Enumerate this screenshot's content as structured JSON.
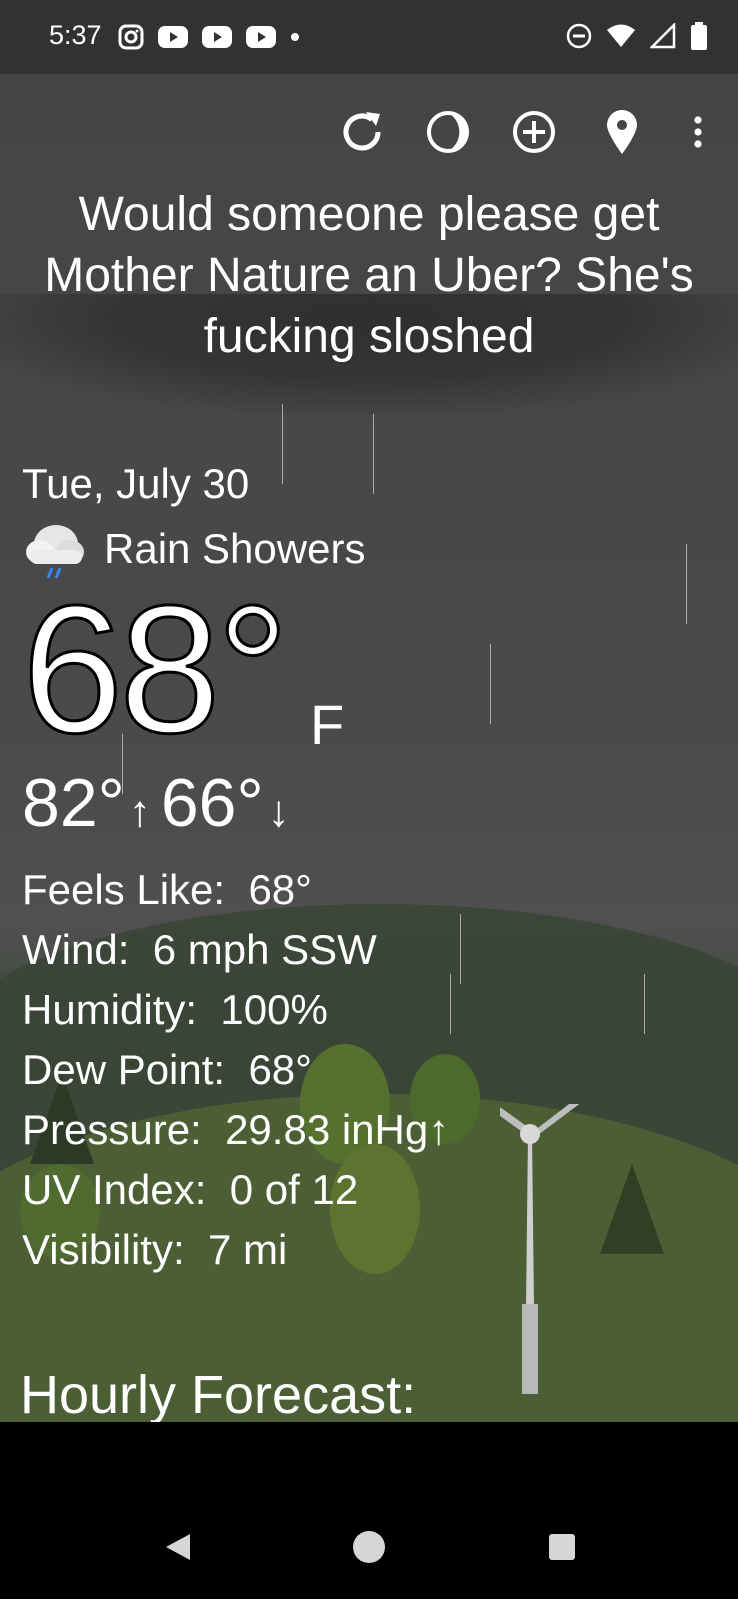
{
  "status_bar": {
    "time": "5:37",
    "left_icons": [
      "instagram-icon",
      "youtube-icon",
      "youtube-icon",
      "youtube-icon",
      "dot-icon"
    ],
    "right_icons": [
      "dnd-icon",
      "wifi-icon",
      "signal-icon",
      "battery-icon"
    ]
  },
  "toolbar": {
    "icons": [
      "refresh-icon",
      "moon-phase-icon",
      "add-location-icon",
      "location-pin-icon",
      "more-vert-icon"
    ]
  },
  "headline": "Would someone please get Mother Nature an Uber? She's fucking sloshed",
  "weather": {
    "date": "Tue, July 30",
    "condition": "Rain Showers",
    "condition_icon": "rain-cloud-icon",
    "temperature": "68°",
    "unit": "F",
    "high": "82°",
    "low": "66°",
    "high_arrow": "↑",
    "low_arrow": "↓"
  },
  "details": [
    {
      "label": "Feels Like:",
      "value": "68°"
    },
    {
      "label": "Wind:",
      "value": "6 mph SSW"
    },
    {
      "label": "Humidity:",
      "value": "100%"
    },
    {
      "label": "Dew Point:",
      "value": "68°"
    },
    {
      "label": "Pressure:",
      "value": "29.83 inHg↑"
    },
    {
      "label": "UV Index:",
      "value": "0 of 12"
    },
    {
      "label": "Visibility:",
      "value": "7 mi"
    }
  ],
  "hourly_title": "Hourly Forecast:",
  "nav_bar": {
    "buttons": [
      "back-icon",
      "home-icon",
      "recents-icon"
    ]
  },
  "colors": {
    "status_bar": "#323232",
    "sky": "#474747",
    "grass": "#4b5e34",
    "rain_drop": "#3b82f6"
  }
}
